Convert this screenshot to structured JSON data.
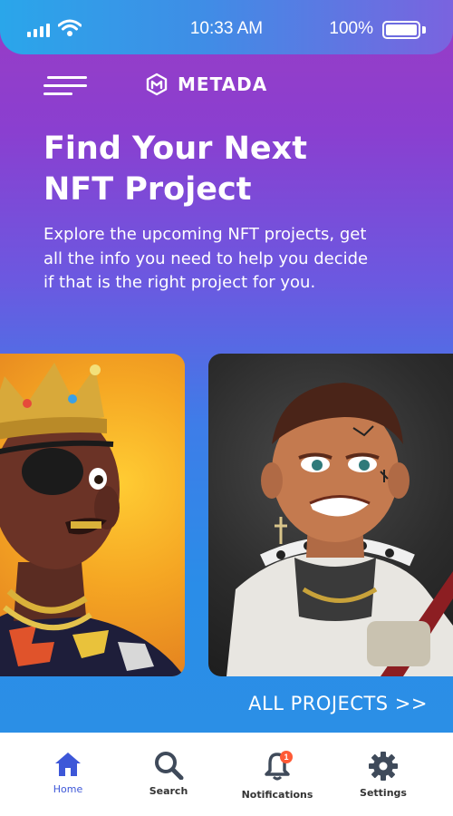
{
  "status_bar": {
    "time": "10:33 AM",
    "battery_percent": "100%",
    "battery_level": 1.0,
    "icons": [
      "signal-icon",
      "wifi-icon",
      "battery-icon"
    ]
  },
  "header": {
    "menu_icon": "hamburger-menu-icon",
    "logo_icon": "metada-logo-icon",
    "brand_name": "METADA"
  },
  "hero": {
    "title_line1": "Find Your Next",
    "title_line2": "NFT Project",
    "description": "Explore the upcoming NFT projects, get all the info you need to help you decide if that is the right project for you."
  },
  "projects": {
    "cards": [
      {
        "image": "nft-crowned-avatar-image",
        "accent": "#f5a623"
      },
      {
        "image": "nft-tattooed-avatar-image",
        "accent": "#2c2c2c"
      }
    ],
    "all_projects_label": "ALL PROJECTS >>"
  },
  "tabbar": {
    "tabs": [
      {
        "label": "Home",
        "icon": "home-icon",
        "active": true
      },
      {
        "label": "Search",
        "icon": "search-icon",
        "active": false
      },
      {
        "label": "Notifications",
        "icon": "bell-icon",
        "active": false,
        "badge": "1"
      },
      {
        "label": "Settings",
        "icon": "gear-icon",
        "active": false
      }
    ]
  },
  "colors": {
    "gradient_top": "#9a3cc4",
    "gradient_bottom": "#2b8fe6",
    "active_tab": "#3d57d8",
    "badge": "#ff5a36"
  }
}
